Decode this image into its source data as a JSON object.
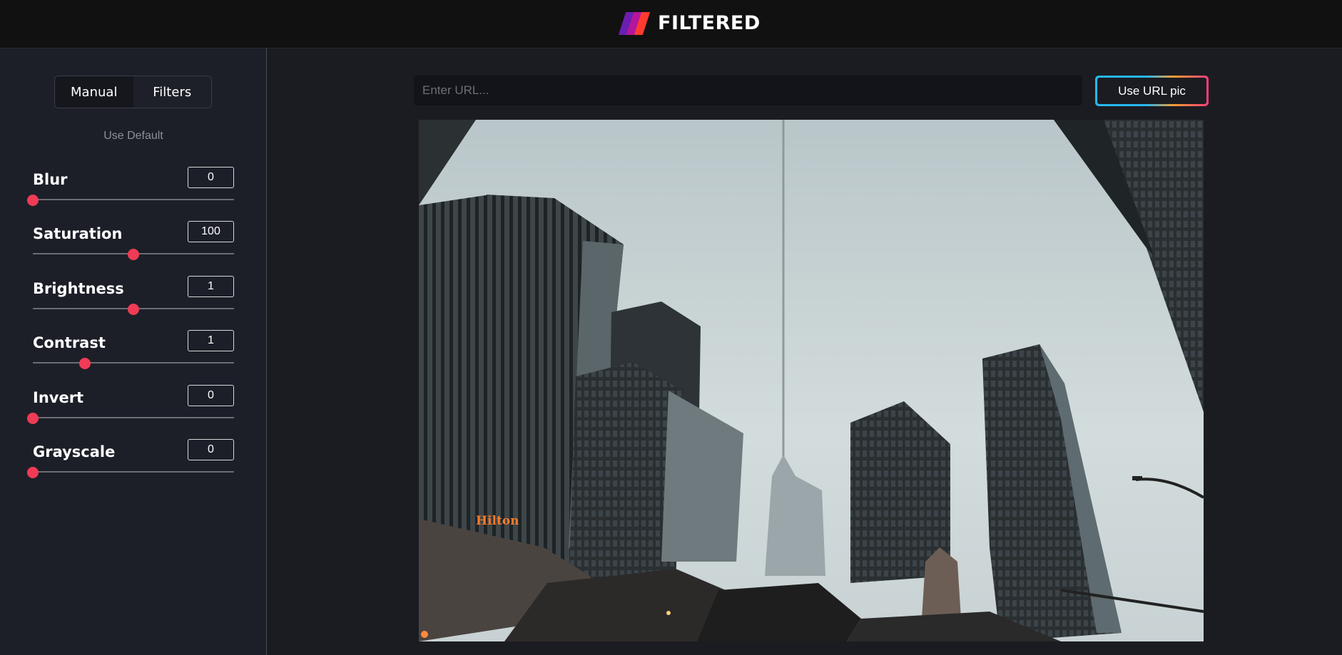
{
  "app": {
    "title": "FILTERED",
    "logo_icon": "three-stripes-logo-icon"
  },
  "tabs": [
    {
      "label": "Manual",
      "active": true
    },
    {
      "label": "Filters",
      "active": false
    }
  ],
  "use_default_label": "Use Default",
  "controls": [
    {
      "label": "Blur",
      "value": "0",
      "level": 0.0
    },
    {
      "label": "Saturation",
      "value": "100",
      "level": 0.5
    },
    {
      "label": "Brightness",
      "value": "1",
      "level": 0.5
    },
    {
      "label": "Contrast",
      "value": "1",
      "level": 0.26
    },
    {
      "label": "Invert",
      "value": "0",
      "level": 0.0
    },
    {
      "label": "Grayscale",
      "value": "0",
      "level": 0.0
    }
  ],
  "url": {
    "placeholder": "Enter URL...",
    "value": "",
    "button_label": "Use URL pic"
  },
  "image": {
    "subject": "city-skyscrapers-photo",
    "sign_text": "Hilton"
  },
  "colors": {
    "accent": "#ef3b55",
    "button_gradient": [
      "#26b8f0",
      "#ff9d2e",
      "#f23c7e"
    ]
  }
}
